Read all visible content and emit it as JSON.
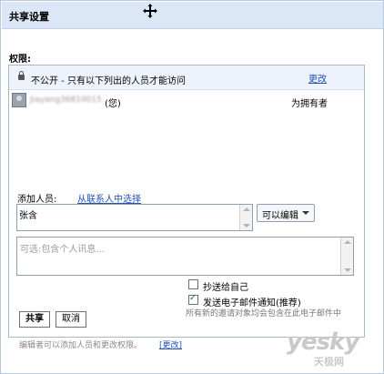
{
  "dialog": {
    "title": "共享设置",
    "move_icon": "move-cross-icon"
  },
  "permissions": {
    "label": "权限:",
    "visibility_text": "不公开 - 只有以下列出的人员才能访问",
    "change_link": "更改",
    "members": [
      {
        "name": "Jiayang36810015",
        "suffix": "(您)",
        "role": "为拥有者"
      }
    ]
  },
  "add_people": {
    "label": "添加人员:",
    "contacts_link": "从联系人中选择",
    "value": "张含",
    "role": "可以编辑",
    "message_placeholder": "可选:包含个人讯息..."
  },
  "options": {
    "copy_self": {
      "label": "抄送给自己",
      "checked": false
    },
    "send_email": {
      "label": "发送电子邮件通知(推荐)",
      "checked": true,
      "note": "所有新的邀请对象均会包含在此电子邮件中"
    }
  },
  "buttons": {
    "share": "共享",
    "cancel": "取消"
  },
  "footer": {
    "note": "编辑者可以添加人员和更改权限。",
    "link": "[更改]"
  },
  "watermark": {
    "text": "yesky",
    "sub": "天极网"
  },
  "colors": {
    "title_bar": "#dbe6f6",
    "link": "#2350b7",
    "panel_border": "#a9b7cc"
  }
}
